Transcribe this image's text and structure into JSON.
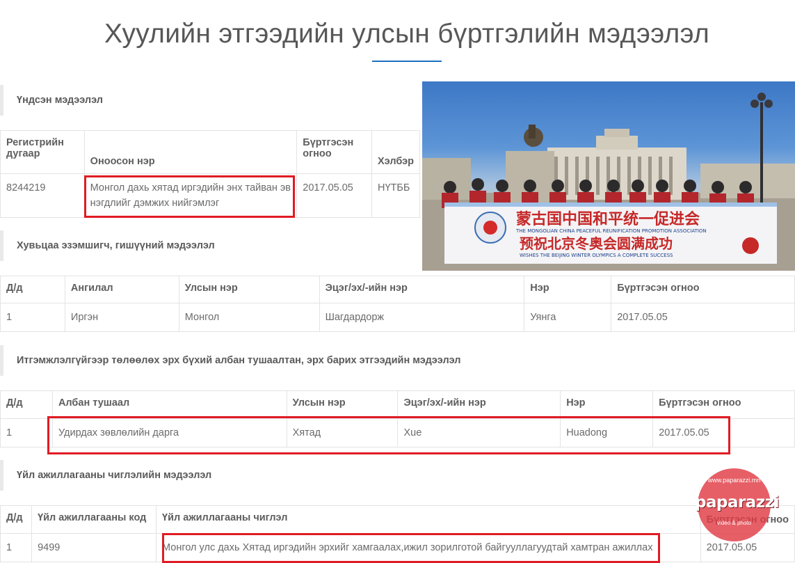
{
  "page": {
    "title": "Хуулийн этгээдийн улсын бүртгэлийн мэдээлэл"
  },
  "basic": {
    "heading": "Үндсэн мэдээлэл",
    "headers": [
      "Регистрийн дугаар",
      "Оноосон нэр",
      "Бүртгэсэн огноо",
      "Хэлбэр"
    ],
    "row": [
      "8244219",
      "Монгол дахь хятад иргэдийн энх тайван эв нэгдлийг дэмжих нийгэмлэг",
      "2017.05.05",
      "НҮТББ"
    ]
  },
  "shareholders": {
    "heading": "Хувьцаа эзэмшигч, гишүүний мэдээлэл",
    "headers": [
      "Д/д",
      "Ангилал",
      "Улсын нэр",
      "Эцэг/эх/-ийн нэр",
      "Нэр",
      "Бүртгэсэн огноо"
    ],
    "row": [
      "1",
      "Иргэн",
      "Монгол",
      "Шагдардорж",
      "Уянга",
      "2017.05.05"
    ]
  },
  "officials": {
    "heading": "Итгэмжлэлгүйгээр төлөөлөх эрх бүхий албан тушаалтан, эрх барих этгээдийн мэдээлэл",
    "headers": [
      "Д/д",
      "Албан тушаал",
      "Улсын нэр",
      "Эцэг/эх/-ийн нэр",
      "Нэр",
      "Бүртгэсэн огноо"
    ],
    "row": [
      "1",
      "Удирдах зөвлөлийн дарга",
      "Хятад",
      "Xue",
      "Huadong",
      "2017.05.05"
    ]
  },
  "activity": {
    "heading": "Үйл ажиллагааны чиглэлийн мэдээлэл",
    "headers": [
      "Д/д",
      "Үйл ажиллагааны код",
      "Үйл ажиллагааны чиглэл",
      "Бүртгэсэн огноо"
    ],
    "row": [
      "1",
      "9499",
      "Монгол улс дахь Хятад иргэдийн эрхийг хамгаалах,ижил зорилготой байгууллагуудтай хамтран ажиллах",
      "2017.05.05"
    ]
  },
  "photo": {
    "banner_top": "蒙古国中国和平统一促进会",
    "banner_en1": "THE MONGOLIAN CHINA PEACEFUL REUNIFICATION PROMOTION ASSOCIATION",
    "banner_mid": "预祝北京冬奥会圆满成功",
    "banner_en2": "WISHES THE BEIJING WINTER OLYMPICS A COMPLETE SUCCESS"
  },
  "watermark": {
    "brand": "paparazzi",
    "url": "www.paparazzi.mn",
    "tag": "video & photo"
  },
  "colors": {
    "highlight": "#e01b23",
    "accent": "#1e6fc0"
  }
}
